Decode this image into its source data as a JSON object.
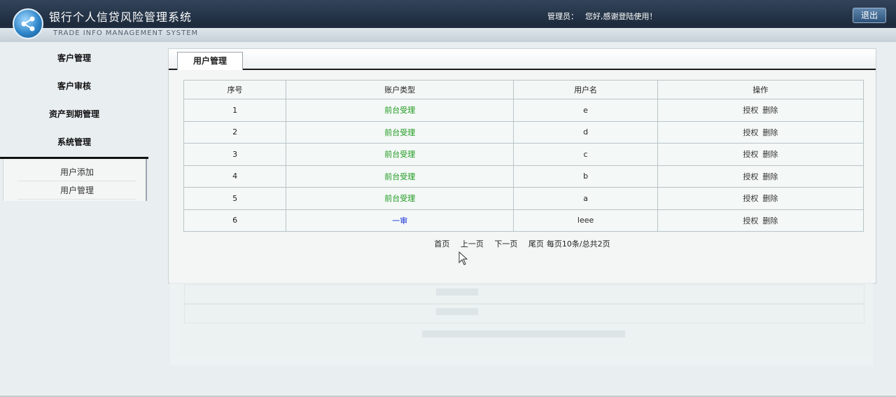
{
  "header": {
    "title": "银行个人信贷风险管理系统",
    "subtitle": "TRADE INFO MANAGEMENT SYSTEM",
    "admin_label": "管理员：",
    "greeting": "您好,感谢登陆使用！",
    "logout_label": "退出"
  },
  "sidebar": {
    "items": [
      {
        "label": "客户管理"
      },
      {
        "label": "客户审核"
      },
      {
        "label": "资产到期管理"
      },
      {
        "label": "系统管理"
      }
    ],
    "sub_items": [
      {
        "label": "用户添加"
      },
      {
        "label": "用户管理"
      }
    ]
  },
  "main": {
    "tab_label": "用户管理",
    "columns": [
      "序号",
      "账户类型",
      "用户名",
      "操作"
    ],
    "rows": [
      {
        "no": "1",
        "type": "前台受理",
        "username": "e"
      },
      {
        "no": "2",
        "type": "前台受理",
        "username": "d"
      },
      {
        "no": "3",
        "type": "前台受理",
        "username": "c"
      },
      {
        "no": "4",
        "type": "前台受理",
        "username": "b"
      },
      {
        "no": "5",
        "type": "前台受理",
        "username": "a"
      },
      {
        "no": "6",
        "type": "一审",
        "username": "leee"
      }
    ],
    "actions": {
      "authorize": "授权",
      "delete": "删除"
    },
    "pager": {
      "first": "首页",
      "prev": "上一页",
      "next": "下一页",
      "last": "尾页",
      "summary": "每页10条/总共2页"
    }
  },
  "colors": {
    "type_front": "#1f9a1f",
    "type_first_review": "#1c34d9",
    "header_bg": "#1d2b3d"
  }
}
